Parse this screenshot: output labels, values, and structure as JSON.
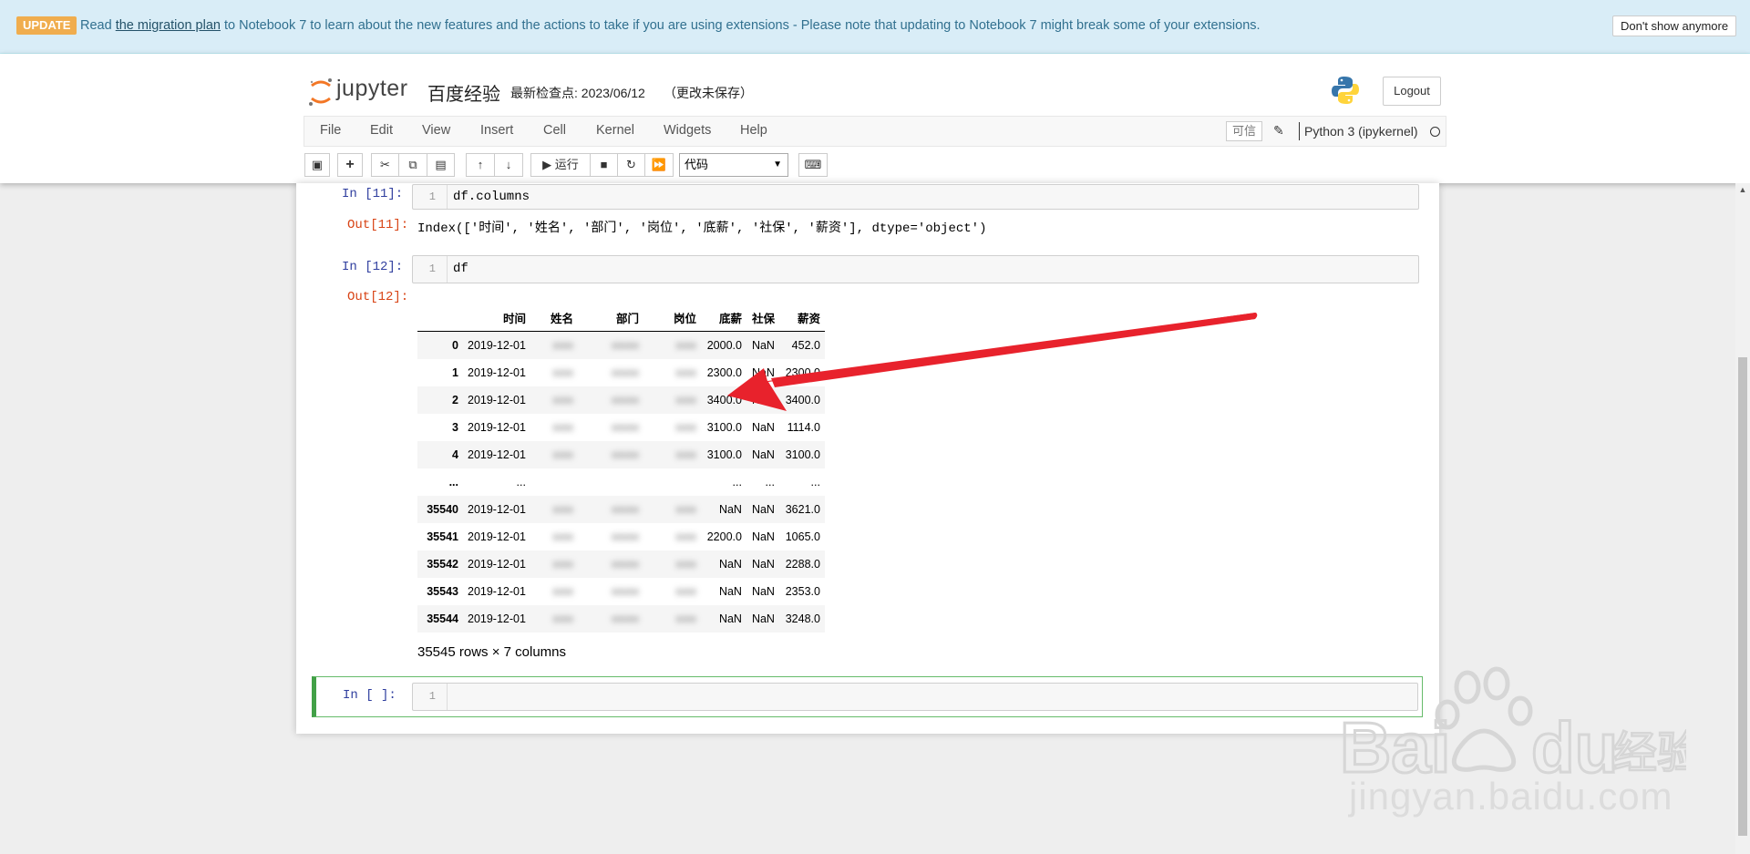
{
  "banner": {
    "badge": "UPDATE",
    "msg_prefix": "Read ",
    "link": "the migration plan",
    "msg_suffix": " to Notebook 7 to learn about the new features and the actions to take if you are using extensions - Please note that updating to Notebook 7 might break some of your extensions.",
    "dismiss": "Don't show anymore"
  },
  "header": {
    "brand": "jupyter",
    "notebook_title": "百度经验",
    "checkpoint": "最新检查点: 2023/06/12",
    "unsaved": "（更改未保存）",
    "logout": "Logout"
  },
  "menu": [
    "File",
    "Edit",
    "View",
    "Insert",
    "Cell",
    "Kernel",
    "Widgets",
    "Help"
  ],
  "kernel": {
    "trusted": "可信",
    "name": "Python 3 (ipykernel)"
  },
  "toolbar": {
    "run_label": "运行",
    "cell_type": "代码"
  },
  "cells": [
    {
      "in_prompt": "In [11]:",
      "line": "1",
      "code": "df.columns",
      "out_prompt": "Out[11]:",
      "output": "Index(['时间', '姓名', '部门', '岗位', '底薪', '社保', '薪资'], dtype='object')"
    },
    {
      "in_prompt": "In [12]:",
      "line": "1",
      "code": "df",
      "out_prompt": "Out[12]:"
    },
    {
      "in_prompt": "In [ ]:",
      "line": "1",
      "code": ""
    }
  ],
  "dataframe": {
    "columns": [
      "",
      "时间",
      "姓名",
      "部门",
      "岗位",
      "底薪",
      "社保",
      "薪资"
    ],
    "rows": [
      [
        "0",
        "2019-12-01",
        "■■■",
        "■■■■",
        "■■■",
        "2000.0",
        "NaN",
        "452.0"
      ],
      [
        "1",
        "2019-12-01",
        "■■■",
        "■■■■",
        "■■■",
        "2300.0",
        "NaN",
        "2300.0"
      ],
      [
        "2",
        "2019-12-01",
        "■■■",
        "■■■■",
        "■■■",
        "3400.0",
        "NaN",
        "3400.0"
      ],
      [
        "3",
        "2019-12-01",
        "■■■",
        "■■■■",
        "■■■",
        "3100.0",
        "NaN",
        "1114.0"
      ],
      [
        "4",
        "2019-12-01",
        "■■■",
        "■■■■",
        "■■■",
        "3100.0",
        "NaN",
        "3100.0"
      ],
      [
        "...",
        "...",
        "",
        "",
        "",
        "...",
        "...",
        "..."
      ],
      [
        "35540",
        "2019-12-01",
        "■■■",
        "■■■■",
        "■■■",
        "NaN",
        "NaN",
        "3621.0"
      ],
      [
        "35541",
        "2019-12-01",
        "■■■",
        "■■■■",
        "■■■",
        "2200.0",
        "NaN",
        "1065.0"
      ],
      [
        "35542",
        "2019-12-01",
        "■■■",
        "■■■■",
        "■■■",
        "NaN",
        "NaN",
        "2288.0"
      ],
      [
        "35543",
        "2019-12-01",
        "■■■",
        "■■■■",
        "■■■",
        "NaN",
        "NaN",
        "2353.0"
      ],
      [
        "35544",
        "2019-12-01",
        "■■■",
        "■■■■",
        "■■■",
        "NaN",
        "NaN",
        "3248.0"
      ]
    ],
    "shape": "35545 rows × 7 columns"
  },
  "watermark": {
    "text": "jingyan.baidu.com"
  },
  "colors": {
    "banner_bg": "#d9edf7",
    "in_prompt": "#303f9f",
    "out_prompt": "#d84315",
    "active_border": "#42a047",
    "arrow": "#e8222c"
  }
}
